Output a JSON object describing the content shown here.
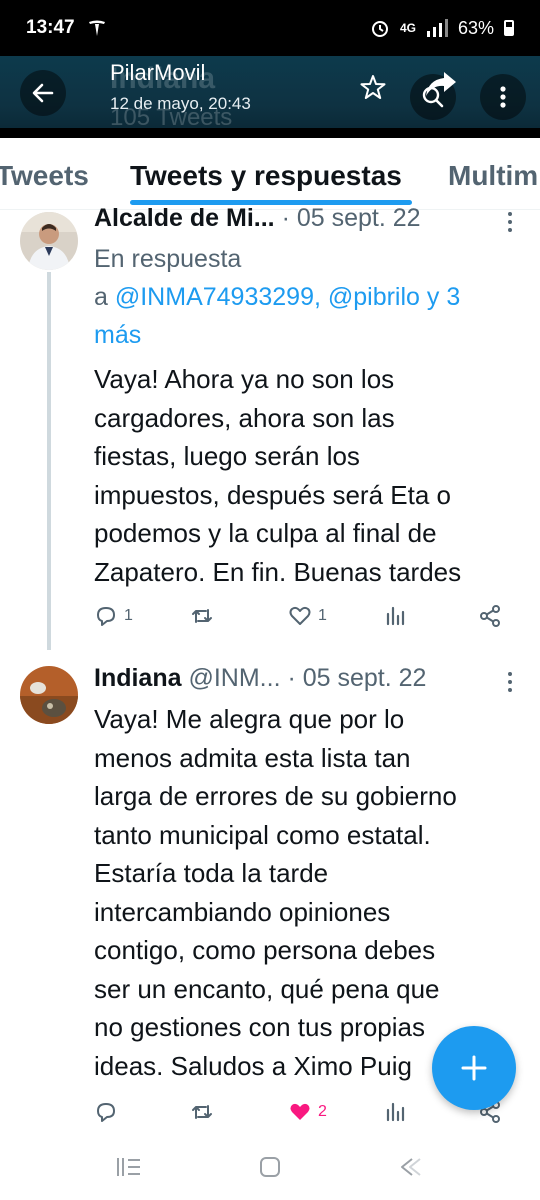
{
  "status_bar": {
    "time": "13:47",
    "network": "4G",
    "battery": "63%"
  },
  "header": {
    "account_name": "PilarMovil",
    "date": "12 de mayo, 20:43",
    "profile_name": "Indiana",
    "tweet_count": "105 Tweets"
  },
  "tabs": [
    {
      "label": "Tweets"
    },
    {
      "label": "Tweets y respuestas"
    },
    {
      "label": "Multim"
    }
  ],
  "tweets": [
    {
      "name": "Alcalde de Mi...",
      "handle": "",
      "date": "· 05 sept. 22",
      "reply_prefix": "En respuesta",
      "reply_a": "a",
      "reply_mentions": "@INMA74933299, @pibrilo",
      "reply_suffix": "y 3",
      "reply_more": "más",
      "lines": [
        "Vaya! Ahora ya no son los",
        "cargadores, ahora son las",
        "fiestas, luego serán los",
        "impuestos, después será Eta o",
        "podemos y la culpa al final de",
        "Zapatero. En fin. Buenas tardes"
      ],
      "replies": "1",
      "retweets": "",
      "likes": "1"
    },
    {
      "name": "Indiana",
      "handle": "@INM...",
      "date": "· 05 sept. 22",
      "lines": [
        "Vaya! Me alegra que por lo",
        "menos admita esta lista tan",
        "larga de errores de su gobierno",
        "tanto municipal como estatal.",
        "Estaría toda la tarde",
        "intercambiando opiniones",
        "contigo, como persona debes",
        "ser un encanto, qué pena que",
        "no gestiones con tus propias",
        "ideas. Saludos a Ximo Puig"
      ],
      "replies": "",
      "retweets": "",
      "likes": "2"
    }
  ],
  "colors": {
    "accent": "#1d9bf0",
    "like": "#f91880",
    "header_bg": "#0e3242"
  },
  "icons": [
    "back-arrow-icon",
    "star-icon",
    "search-icon",
    "share-icon",
    "more-vertical-icon",
    "reply-icon",
    "retweet-icon",
    "like-icon",
    "analytics-icon",
    "share-node-icon",
    "compose-plus-icon"
  ]
}
